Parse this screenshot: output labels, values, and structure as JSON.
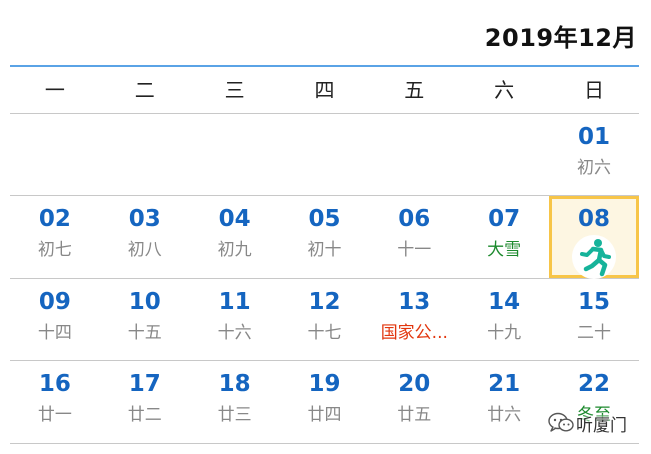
{
  "header": {
    "title": "2019年12月"
  },
  "weekdays": [
    "一",
    "二",
    "三",
    "四",
    "五",
    "六",
    "日"
  ],
  "weeks": [
    [
      {
        "day": "",
        "lunar": ""
      },
      {
        "day": "",
        "lunar": ""
      },
      {
        "day": "",
        "lunar": ""
      },
      {
        "day": "",
        "lunar": ""
      },
      {
        "day": "",
        "lunar": ""
      },
      {
        "day": "",
        "lunar": ""
      },
      {
        "day": "01",
        "lunar": "初六"
      }
    ],
    [
      {
        "day": "02",
        "lunar": "初七"
      },
      {
        "day": "03",
        "lunar": "初八"
      },
      {
        "day": "04",
        "lunar": "初九"
      },
      {
        "day": "05",
        "lunar": "初十"
      },
      {
        "day": "06",
        "lunar": "十一"
      },
      {
        "day": "07",
        "lunar": "大雪"
      },
      {
        "day": "08",
        "lunar": ""
      }
    ],
    [
      {
        "day": "09",
        "lunar": "十四"
      },
      {
        "day": "10",
        "lunar": "十五"
      },
      {
        "day": "11",
        "lunar": "十六"
      },
      {
        "day": "12",
        "lunar": "十七"
      },
      {
        "day": "13",
        "lunar": "国家公..."
      },
      {
        "day": "14",
        "lunar": "十九"
      },
      {
        "day": "15",
        "lunar": "二十"
      }
    ],
    [
      {
        "day": "16",
        "lunar": "廿一"
      },
      {
        "day": "17",
        "lunar": "廿二"
      },
      {
        "day": "18",
        "lunar": "廿三"
      },
      {
        "day": "19",
        "lunar": "廿四"
      },
      {
        "day": "20",
        "lunar": "廿五"
      },
      {
        "day": "21",
        "lunar": "廿六"
      },
      {
        "day": "22",
        "lunar": "冬至"
      }
    ]
  ],
  "special": {
    "today_icon": "running-person-icon",
    "solar_term_color": "#1d8a2e",
    "holiday_color": "#e2360e",
    "today_border_color": "#f7c548"
  },
  "watermark": {
    "text": "听厦门",
    "icon": "wechat-icon"
  },
  "colors": {
    "day_number": "#1565c0",
    "accent_line": "#5aa3e6"
  }
}
